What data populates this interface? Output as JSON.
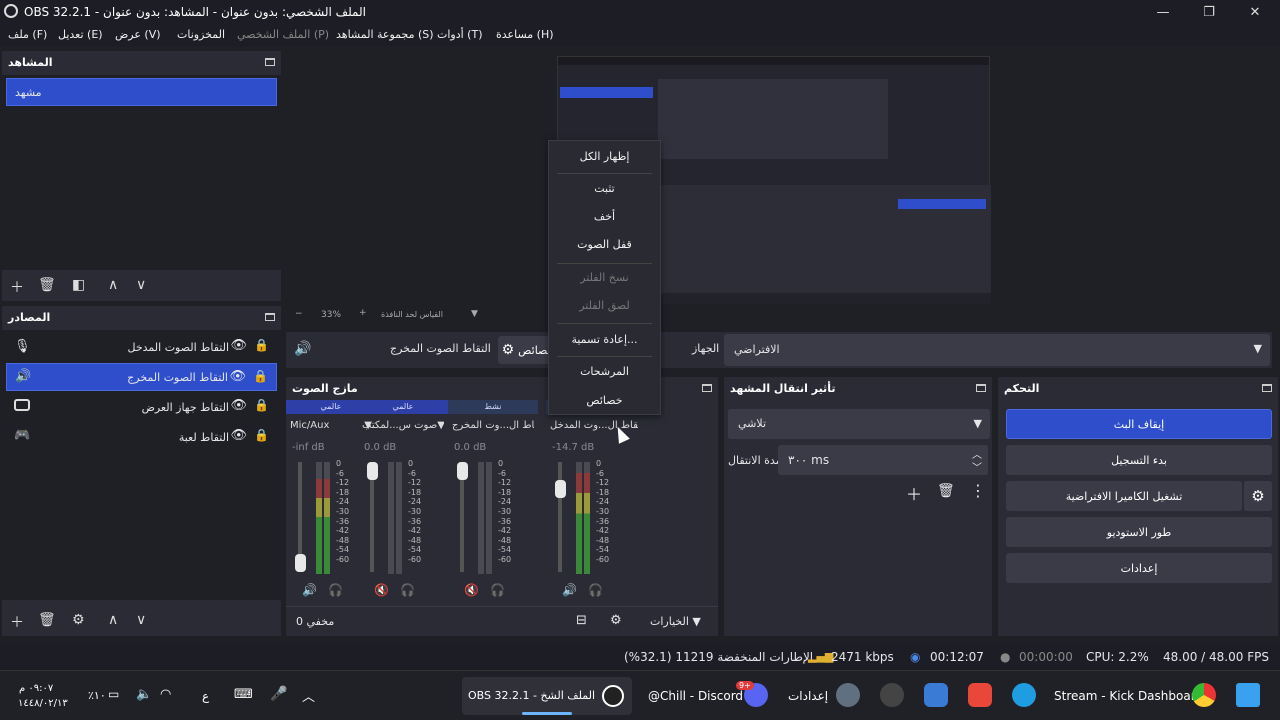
{
  "window": {
    "title": "OBS 32.2.1 - الملف الشخصي: بدون عنوان - المشاهد: بدون عنوان",
    "minimize": "—",
    "maximize": "❐",
    "close": "✕"
  },
  "menu": {
    "file": "ملف (F)",
    "edit": "تعديل (E)",
    "view": "عرض (V)",
    "docks": "المخزونات",
    "profile": "الملف الشخصي (P)",
    "scene_collection": "مجموعة المشاهد (S)",
    "tools": "أدوات (T)",
    "help": "مساعدة (H)"
  },
  "scenes": {
    "title": "المشاهد",
    "items": [
      "مشهد"
    ]
  },
  "sources": {
    "title": "المصادر",
    "items": [
      {
        "label": "التقاط الصوت المدخل",
        "icon": "microphone-icon"
      },
      {
        "label": "التقاط الصوت المخرج",
        "icon": "speaker-icon"
      },
      {
        "label": "التقاط جهاز العرض",
        "icon": "monitor-icon"
      },
      {
        "label": "التقاط لعبة",
        "icon": "gamepad-icon"
      }
    ]
  },
  "preview": {
    "zoom": "33%",
    "scale_label": "القياس لحد النافذة"
  },
  "source_props": {
    "name": "التقاط الصوت المخرج",
    "props_button": "خصائص",
    "device_label": "الجهاز",
    "device_value": "الافتراضي"
  },
  "mixer": {
    "title": "مازج الصوت",
    "channels": [
      {
        "tab": "عالمي",
        "name": "Mic/Aux",
        "db": "-inf dB",
        "muted": false,
        "level": 0.0
      },
      {
        "tab": "عالمي",
        "name": "صوت س...لمكتب",
        "db": "0.0 dB",
        "muted": true,
        "level": 0.0
      },
      {
        "tab": "نشط",
        "name": "التقاط ال...وت المخرج",
        "db": "0.0 dB",
        "muted": true,
        "level": 0.0
      },
      {
        "tab": "نشط",
        "name": "التقاط ال...وت المدخل",
        "db": "-14.7 dB",
        "muted": false,
        "level": 0.8
      }
    ],
    "scale": [
      "0",
      "-6",
      "-12",
      "-18",
      "-24",
      "-30",
      "-36",
      "-42",
      "-48",
      "-54",
      "-60"
    ],
    "hidden_label": "مخفي 0",
    "options": "الخيارات"
  },
  "context_menu": {
    "show_all": "إظهار الكل",
    "lock": "تثبت",
    "hide": "أخف",
    "mute": "قفل الصوت",
    "copy_filters": "نسخ الفلتر",
    "paste_filters": "لصق الفلتر",
    "rename": "إعادة تسمية...",
    "filters": "المرشحات",
    "properties": "خصائص"
  },
  "transitions": {
    "title": "تأثير انتقال المشهد",
    "type": "تلاشي",
    "duration_label": "مدة الانتقال",
    "duration": "٣٠٠ ms"
  },
  "controls": {
    "title": "التحكم",
    "stop_stream": "إيقاف البث",
    "start_record": "بدء التسجيل",
    "virtual_cam": "تشغيل الكاميرا الافتراضية",
    "studio_mode": "طور الاستوديو",
    "settings": "إعدادات"
  },
  "status": {
    "dropped": "الإطارات المنخفضة 11219 (32.1%)",
    "bitrate": "2471 kbps",
    "stream_time": "00:12:07",
    "rec_time": "00:00:00",
    "cpu": "CPU: 2.2%",
    "fps": "48.00 / 48.00 FPS"
  },
  "taskbar": {
    "time": "٠٩:٠٧ م",
    "date": "١٤٤٨/٠٢/١٣",
    "battery": "٪١٠",
    "lang": "ع",
    "obs_app": "OBS 32.2.1 - الملف الشخ",
    "discord_app": "@Chill - Discord",
    "settings_app": "إعدادات",
    "chrome_app": "Stream - Kick Dashboard",
    "discord_badge": "9+"
  },
  "colors": {
    "accent": "#2e4ecb",
    "bg": "#1f1f26",
    "panel": "#2a2b35",
    "button": "#3a3b47"
  }
}
